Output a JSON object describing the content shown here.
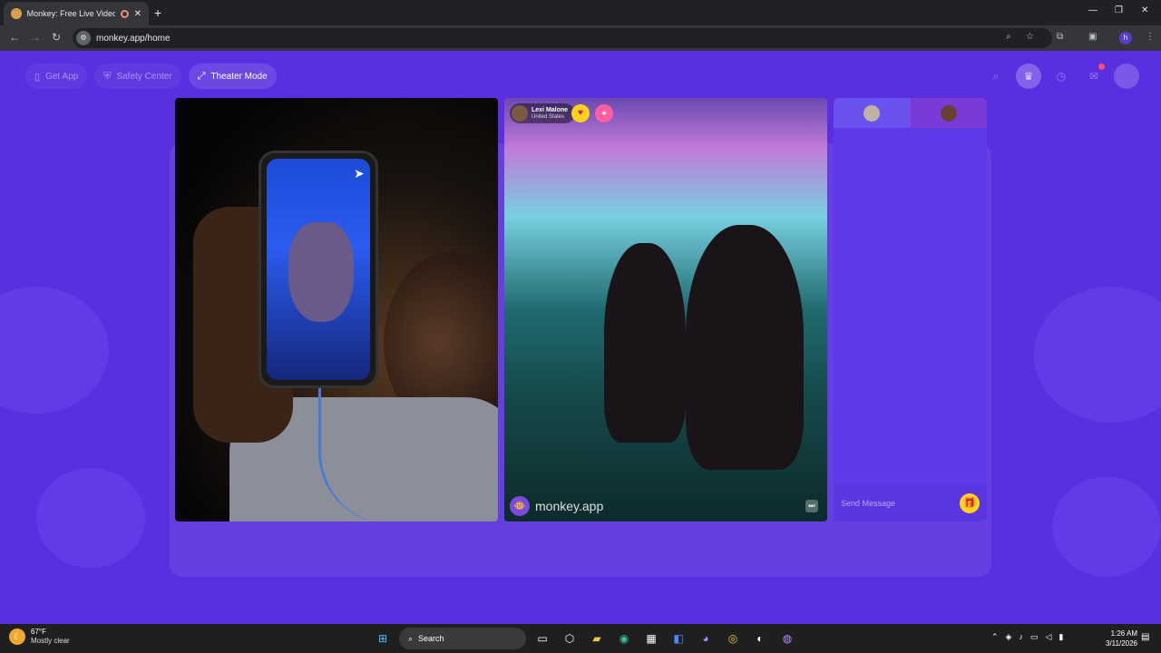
{
  "browser": {
    "tab_title": "Monkey: Free Live Video Ch",
    "url": "monkey.app/home",
    "profile_initial": "h",
    "new_tab": "+",
    "tab_close": "✕"
  },
  "topnav": {
    "items": [
      {
        "label": "Get App",
        "icon": "phone-icon"
      },
      {
        "label": "Safety Center",
        "icon": "shield-icon"
      },
      {
        "label": "Theater Mode",
        "icon": "expand-icon"
      }
    ]
  },
  "video_remote": {
    "user_name": "Lexi Malone",
    "user_country": "United States",
    "watermark": "monkey.app"
  },
  "chat": {
    "placeholder": "Send Message"
  },
  "taskbar": {
    "weather_temp": "67°F",
    "weather_condition": "Mostly clear",
    "search_label": "Search",
    "time": "1:26 AM",
    "date": "3/11/2026"
  },
  "colors": {
    "page_bg": "#5a2fe0",
    "accent_yellow": "#ffd21a",
    "chat_bg": "#5f38e8"
  }
}
